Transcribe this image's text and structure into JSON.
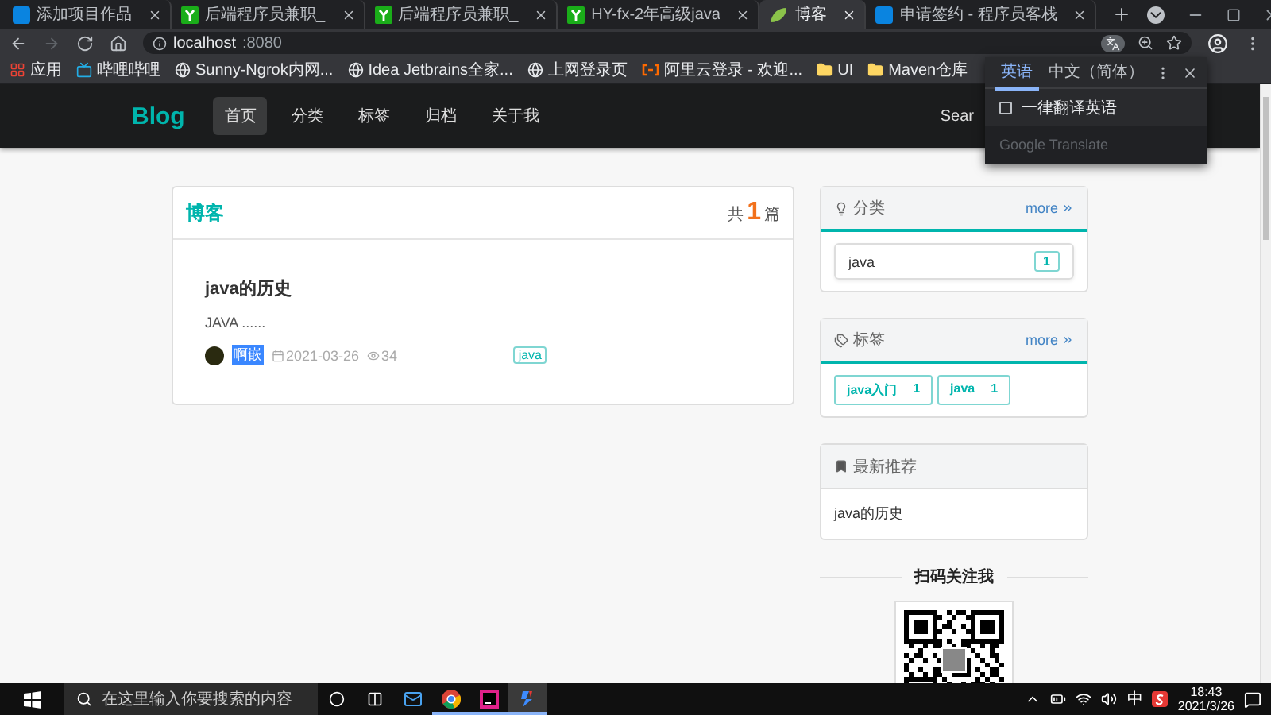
{
  "browser": {
    "tabs": [
      {
        "title": "添加项目作品",
        "kind": "terminal",
        "selected": false
      },
      {
        "title": "后端程序员兼职_",
        "kind": "fork",
        "selected": false
      },
      {
        "title": "后端程序员兼职_",
        "kind": "fork",
        "selected": false
      },
      {
        "title": "HY-fx-2年高级java",
        "kind": "fork",
        "selected": false
      },
      {
        "title": "博客",
        "kind": "leaf",
        "selected": true
      },
      {
        "title": "申请签约 - 程序员客栈",
        "kind": "terminal",
        "selected": false
      }
    ],
    "nav_buttons": [
      {
        "kind": "back",
        "disabled": false
      },
      {
        "kind": "forward",
        "disabled": true
      },
      {
        "kind": "reload",
        "disabled": false
      },
      {
        "kind": "home",
        "disabled": false
      }
    ],
    "address": {
      "host": "localhost",
      "port": ":8080"
    },
    "bookmarks": [
      {
        "label": "应用",
        "kind": "apps"
      },
      {
        "label": "哔哩哔哩",
        "kind": "tv"
      },
      {
        "label": "Sunny-Ngrok内网...",
        "kind": "globe"
      },
      {
        "label": "Idea Jetbrains全家...",
        "kind": "globe"
      },
      {
        "label": "上网登录页",
        "kind": "globe"
      },
      {
        "label": "阿里云登录 - 欢迎...",
        "kind": "cloud"
      },
      {
        "label": "UI",
        "kind": "folder"
      },
      {
        "label": "Maven仓库",
        "kind": "folder"
      }
    ]
  },
  "translate_popup": {
    "languages": [
      {
        "label": "英语",
        "selected": true
      },
      {
        "label": "中文（简体）",
        "selected": false
      }
    ],
    "always_translate": {
      "label": "一律翻译英语",
      "checked": false
    },
    "footer": "Google Translate"
  },
  "site": {
    "brand": "Blog",
    "nav": [
      {
        "label": "首页",
        "selected": true
      },
      {
        "label": "分类",
        "selected": false
      },
      {
        "label": "标签",
        "selected": false
      },
      {
        "label": "归档",
        "selected": false
      },
      {
        "label": "关于我",
        "selected": false
      }
    ],
    "search_label": "Sear"
  },
  "posts_card": {
    "title": "博客",
    "count_prefix": "共",
    "count": "1",
    "count_suffix": "篇",
    "posts": [
      {
        "title": "java的历史",
        "excerpt": "JAVA ......",
        "author": "啊嵌",
        "date": "2021-03-26",
        "views": "34",
        "tag": "java"
      }
    ]
  },
  "sidebar": {
    "categories": {
      "title": "分类",
      "more": "more",
      "items": [
        {
          "name": "java",
          "count": "1"
        }
      ]
    },
    "tags": {
      "title": "标签",
      "more": "more",
      "items": [
        {
          "name": "java入门",
          "count": "1"
        },
        {
          "name": "java",
          "count": "1"
        }
      ]
    },
    "latest": {
      "title": "最新推荐",
      "items": [
        "java的历史"
      ]
    },
    "qr_heading": "扫码关注我"
  },
  "taskbar": {
    "search_placeholder": "在这里输入你要搜索的内容",
    "apps": [
      {
        "kind": "mail",
        "running": false,
        "selected": false
      },
      {
        "kind": "chrome",
        "running": true,
        "selected": false
      },
      {
        "kind": "ide",
        "running": true,
        "selected": false
      },
      {
        "kind": "app",
        "running": true,
        "selected": true
      }
    ],
    "ime": "中",
    "time": "18:43",
    "date": "2021/3/26"
  }
}
